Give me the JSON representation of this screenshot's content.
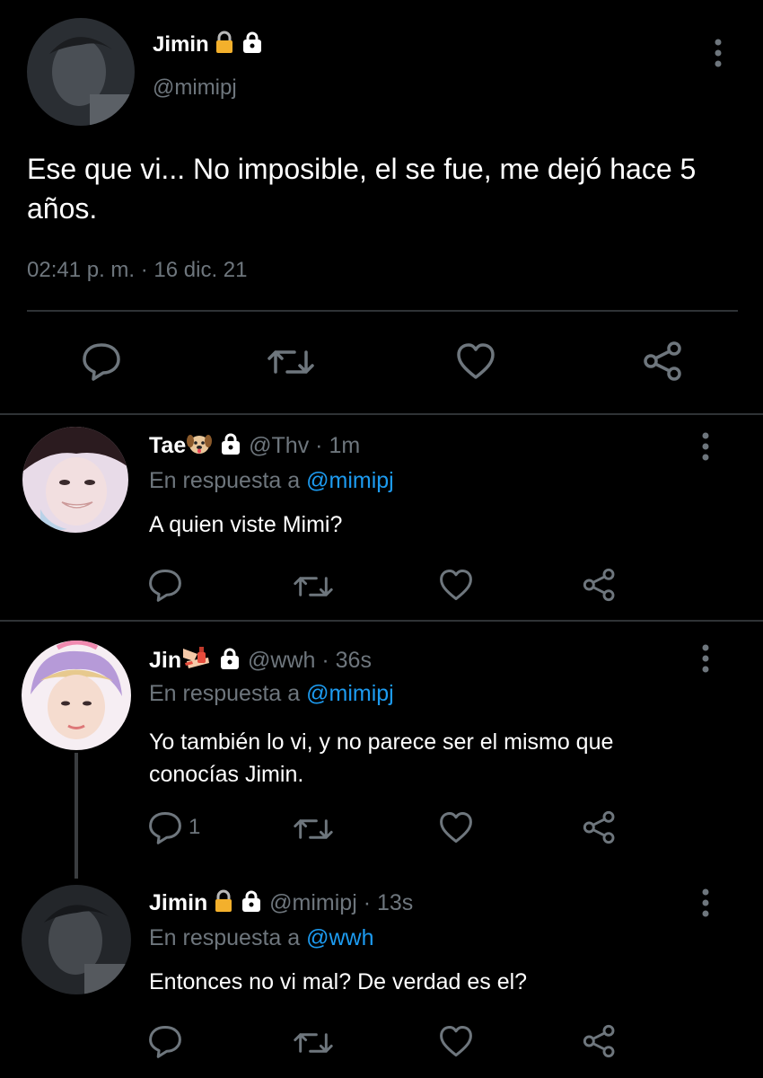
{
  "main_tweet": {
    "display_name": "Jimin",
    "handle": "@mimipj",
    "text": "Ese que vi... No imposible, el se fue, me dejó hace 5 años.",
    "timestamp": "02:41 p. m. · 16 dic. 21",
    "icons": [
      "reply-icon",
      "retweet-icon",
      "like-icon",
      "share-icon"
    ]
  },
  "replies": [
    {
      "display_name": "Tae",
      "handle": "@Thv",
      "time": "1m",
      "reply_prefix": "En respuesta a",
      "reply_to": "@mimipj",
      "text": "A quien viste Mimi?",
      "reply_count": ""
    },
    {
      "display_name": "Jin",
      "handle": "@wwh",
      "time": "36s",
      "reply_prefix": "En respuesta a",
      "reply_to": "@mimipj",
      "text_line1": "Yo también lo vi, y no parece ser el mismo que",
      "text_line2": "conocías Jimin.",
      "reply_count": "1"
    },
    {
      "display_name": "Jimin",
      "handle": "@mimipj",
      "time": "13s",
      "reply_prefix": "En respuesta a",
      "reply_to": "@wwh",
      "text": "Entonces no vi mal? De verdad es el?",
      "reply_count": ""
    }
  ],
  "separator": "·",
  "colors": {
    "background": "#000000",
    "text": "#e7e9ea",
    "muted": "#6e767d",
    "link": "#1d9bf0",
    "divider": "#2f3336"
  }
}
